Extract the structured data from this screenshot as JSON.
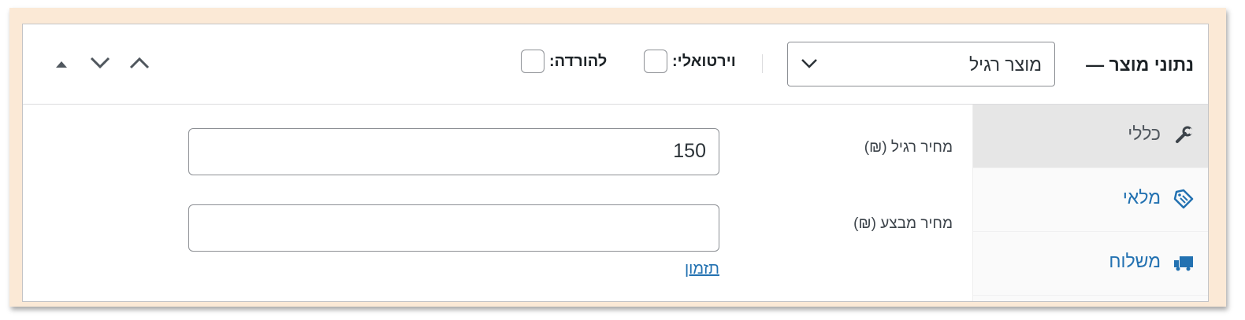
{
  "header": {
    "title": "נתוני מוצר —",
    "product_type": {
      "selected": "מוצר רגיל",
      "icon": "chevron-down-icon"
    },
    "options": {
      "virtual_label": "וירטואלי:",
      "virtual_checked": false,
      "download_label": "להורדה:",
      "download_checked": false
    },
    "controls": [
      "chevron-up-icon",
      "chevron-down-icon",
      "triangle-up-icon"
    ]
  },
  "tabs": [
    {
      "label": "כללי",
      "icon": "wrench-icon",
      "active": true
    },
    {
      "label": "מלאי",
      "icon": "tag-icon",
      "active": false
    },
    {
      "label": "משלוח",
      "icon": "truck-icon",
      "active": false
    }
  ],
  "general": {
    "regular_price_label": "מחיר רגיל (₪)",
    "regular_price_value": "150",
    "sale_price_label": "מחיר מבצע (₪)",
    "sale_price_value": "",
    "schedule_link": "תזמון"
  },
  "colors": {
    "frame": "#fbe9d6",
    "link": "#2271b1",
    "active_tab": "#e6e6e6"
  }
}
